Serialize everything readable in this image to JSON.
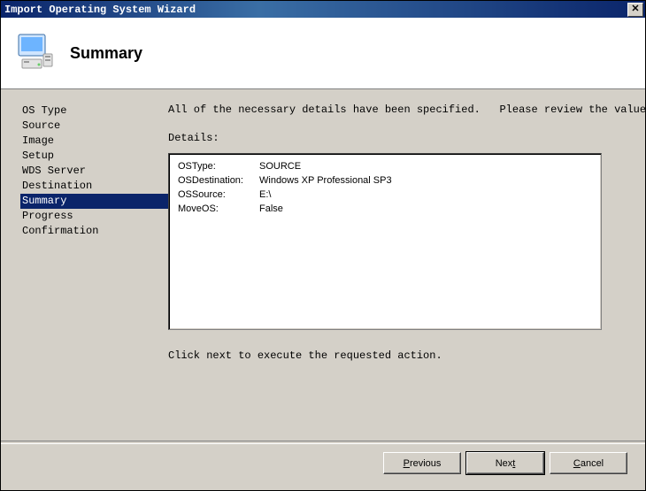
{
  "window": {
    "title": "Import Operating System Wizard"
  },
  "header": {
    "heading": "Summary"
  },
  "sidebar": {
    "items": [
      {
        "label": "OS Type",
        "selected": false
      },
      {
        "label": "Source",
        "selected": false
      },
      {
        "label": "Image",
        "selected": false
      },
      {
        "label": "Setup",
        "selected": false
      },
      {
        "label": "WDS Server",
        "selected": false
      },
      {
        "label": "Destination",
        "selected": false
      },
      {
        "label": "Summary",
        "selected": true
      },
      {
        "label": "Progress",
        "selected": false
      },
      {
        "label": "Confirmation",
        "selected": false
      }
    ]
  },
  "main": {
    "instruction": "All of the necessary details have been specified.   Please review the values below.",
    "details_label": "Details:",
    "details": [
      {
        "key": "OSType:",
        "value": "SOURCE"
      },
      {
        "key": "OSDestination:",
        "value": "Windows XP Professional SP3"
      },
      {
        "key": "OSSource:",
        "value": "E:\\"
      },
      {
        "key": "MoveOS:",
        "value": "False"
      }
    ],
    "footer_instruction": "Click next to execute the requested action."
  },
  "buttons": {
    "previous": {
      "pre": "",
      "u": "P",
      "post": "revious"
    },
    "next": {
      "pre": "Nex",
      "u": "t",
      "post": ""
    },
    "cancel": {
      "pre": "",
      "u": "C",
      "post": "ancel"
    }
  }
}
